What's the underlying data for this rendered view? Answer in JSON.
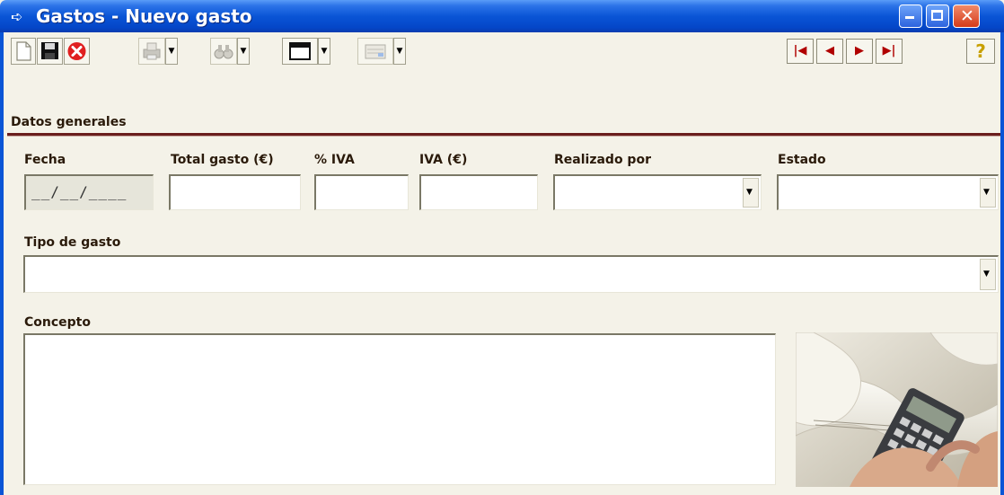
{
  "window": {
    "title": "Gastos - Nuevo gasto",
    "accent": "#0a55d6"
  },
  "toolbar": {
    "items": [
      "new-document-icon",
      "save-icon",
      "cancel-icon",
      "print-icon",
      "find-icon",
      "window-icon",
      "view-icon"
    ],
    "nav": [
      "first-record-icon",
      "previous-record-icon",
      "next-record-icon",
      "last-record-icon",
      "help-icon"
    ]
  },
  "section": {
    "title": "Datos generales"
  },
  "form": {
    "fecha_label": "Fecha",
    "fecha_value": "__/__/____",
    "total_label": "Total gasto (€)",
    "iva_pct_label": "% IVA",
    "iva_label": "IVA (€)",
    "realizado_label": "Realizado por",
    "estado_label": "Estado",
    "tipo_label": "Tipo de gasto",
    "concepto_label": "Concepto"
  }
}
